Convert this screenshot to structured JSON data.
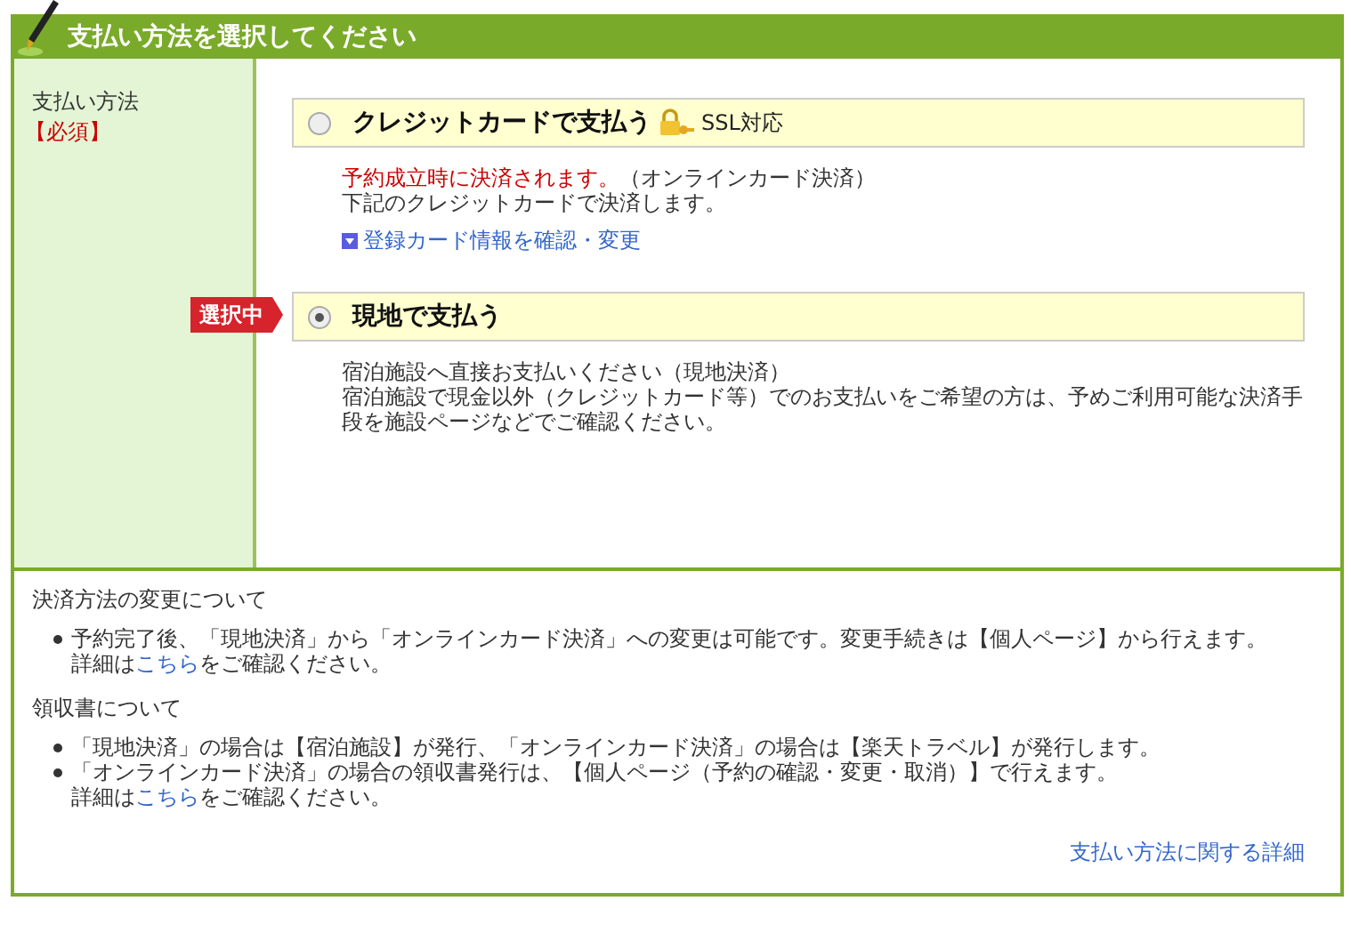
{
  "header": {
    "title": "支払い方法を選択してください"
  },
  "field": {
    "label": "支払い方法",
    "required": "【必須】"
  },
  "selected_badge": "選択中",
  "options": [
    {
      "label": "クレジットカードで支払う",
      "selected": false,
      "secure_label": "SSL対応",
      "notice": "予約成立時に決済されます。",
      "notice_suffix": "（オンラインカード決済）",
      "lines": [
        "下記のクレジットカードで決済します。"
      ],
      "link": "登録カード情報を確認・変更"
    },
    {
      "label": "現地で支払う",
      "selected": true,
      "lines": [
        "宿泊施設へ直接お支払いください（現地決済）",
        "宿泊施設で現金以外（クレジットカード等）でのお支払いをご希望の方は、予めご利用可能な決済手段を施設ページなどでご確認ください。"
      ]
    }
  ],
  "notes": [
    {
      "heading": "決済方法の変更について",
      "bullets": [
        {
          "text": "予約完了後、「現地決済」から「オンラインカード決済」への変更は可能です。変更手続きは【個人ページ】から行えます。",
          "detail": {
            "before": "詳細は",
            "link": "こちら",
            "after": "をご確認ください。"
          }
        }
      ]
    },
    {
      "heading": "領収書について",
      "bullets": [
        {
          "text": "「現地決済」の場合は【宿泊施設】が発行、「オンラインカード決済」の場合は【楽天トラベル】が発行します。"
        },
        {
          "text": "「オンラインカード決済」の場合の領収書発行は、【個人ページ（予約の確認・変更・取消）】で行えます。",
          "detail": {
            "before": "詳細は",
            "link": "こちら",
            "after": "をご確認ください。"
          }
        }
      ]
    }
  ],
  "footer_link": "支払い方法に関する詳細"
}
